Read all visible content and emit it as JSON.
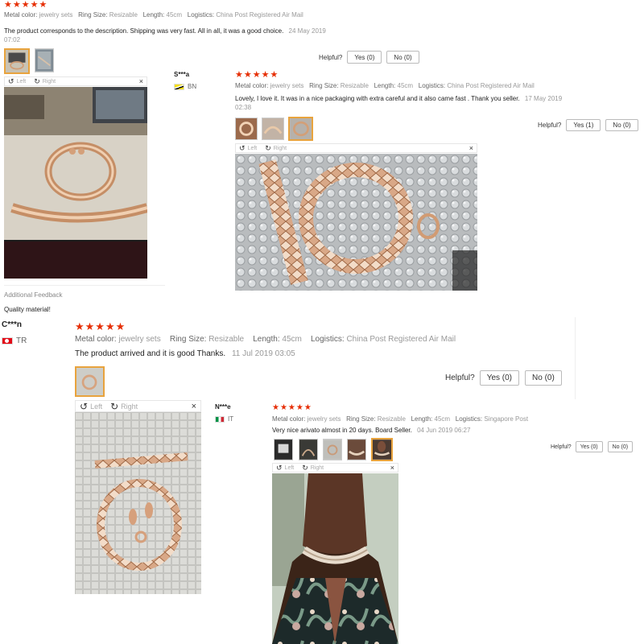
{
  "labels": {
    "metal_color": "Metal color:",
    "ring_size": "Ring Size:",
    "length": "Length:",
    "logistics": "Logistics:",
    "helpful": "Helpful?",
    "left": "Left",
    "right": "Right",
    "close": "×"
  },
  "colors": {
    "star": "#e62e04",
    "active_thumb": "#e8a33d"
  },
  "icons": {
    "rotate_left": "rotate-left-icon",
    "rotate_right": "rotate-right-icon",
    "close": "close-icon",
    "star": "star-icon"
  },
  "review1": {
    "stars": "★★★★★",
    "rating": 5,
    "metal_color": "jewelry sets",
    "ring_size": "Resizable",
    "length": "45cm",
    "logistics": "China Post Registered Air Mail",
    "text": "The product corresponds to the description. Shipping was very fast. All in all, it was a good choice.",
    "date_line1": "24 May 2019",
    "date_line2": "07:02",
    "yes": "Yes (0)",
    "no": "No (0)",
    "additional_feedback_label": "Additional Feedback",
    "additional_feedback_text": "Quality material!"
  },
  "review2": {
    "user": "S***a",
    "country": "BN",
    "stars": "★★★★★",
    "rating": 5,
    "metal_color": "jewelry sets",
    "ring_size": "Resizable",
    "length": "45cm",
    "logistics": "China Post Registered Air Mail",
    "text": "Lovely, I love it. It was in a nice packaging with extra careful and it also came fast . Thank you seller.",
    "date_line1": "17 May 2019",
    "date_line2": "02:38",
    "yes": "Yes (1)",
    "no": "No (0)"
  },
  "review3": {
    "user": "C***n",
    "country": "TR",
    "stars": "★★★★★",
    "rating": 5,
    "metal_color": "jewelry sets",
    "ring_size": "Resizable",
    "length": "45cm",
    "logistics": "China Post Registered Air Mail",
    "text": "The product arrived and it is good Thanks.",
    "date": "11 Jul 2019 03:05",
    "yes": "Yes (0)",
    "no": "No (0)"
  },
  "review4": {
    "user": "N***e",
    "country": "IT",
    "stars": "★★★★★",
    "rating": 5,
    "metal_color": "jewelry sets",
    "ring_size": "Resizable",
    "length": "45cm",
    "logistics": "Singapore Post",
    "text": "Very nice arivato almost in 20 days. Board Seller.",
    "date": "04 Jun 2019 06:27",
    "yes": "Yes (0)",
    "no": "No (0)"
  }
}
